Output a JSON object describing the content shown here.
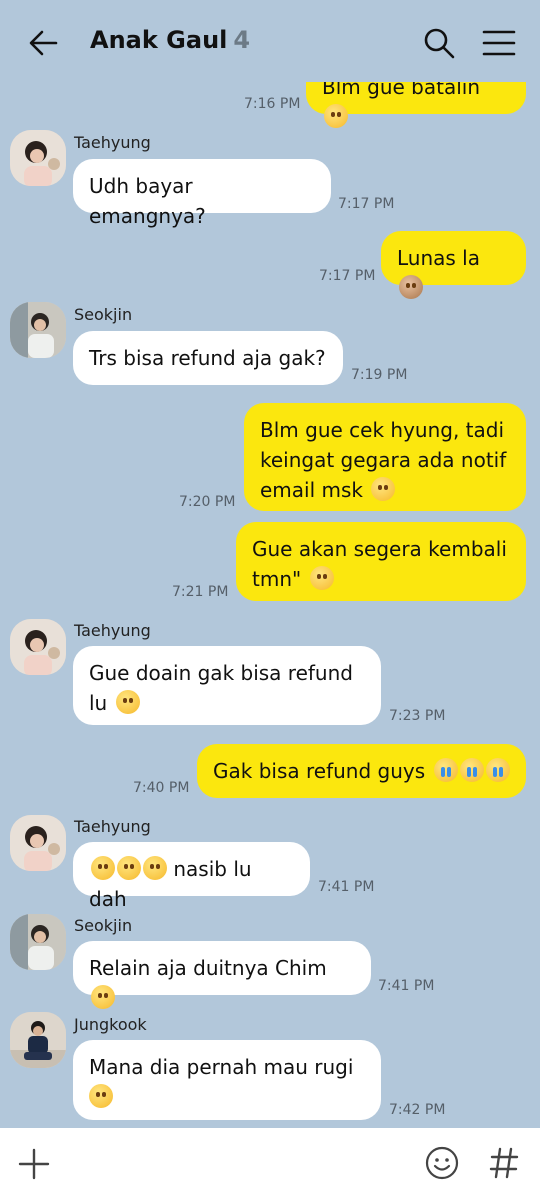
{
  "header": {
    "title": "Anak Gaul",
    "member_count": "4",
    "icons": {
      "back": "arrow-left-icon",
      "search": "search-icon",
      "menu": "hamburger-menu-icon"
    }
  },
  "messages": [
    {
      "type": "out",
      "text": "Blm gue batalin",
      "emoji": "😅",
      "time": "7:16 PM"
    },
    {
      "type": "in",
      "sender": "Taehyung",
      "text": "Udh bayar emangnya?",
      "time": "7:17 PM"
    },
    {
      "type": "out",
      "text": "Lunas la",
      "emoji": "🙈",
      "time": "7:17 PM"
    },
    {
      "type": "in",
      "sender": "Seokjin",
      "text": "Trs bisa refund aja gak?",
      "time": "7:19 PM"
    },
    {
      "type": "out",
      "lines": [
        "Blm gue cek hyung, tadi",
        "keingat gegara ada notif",
        "email msk"
      ],
      "emoji": "😅",
      "time": "7:20 PM"
    },
    {
      "type": "out",
      "lines": [
        "Gue akan segera kembali",
        "tmn\""
      ],
      "emoji": "🫡",
      "time": "7:21 PM"
    },
    {
      "type": "in",
      "sender": "Taehyung",
      "lines": [
        "Gue doain gak bisa refund",
        "lu"
      ],
      "emoji": "😂",
      "time": "7:23 PM"
    },
    {
      "type": "out",
      "text": "Gak bisa refund guys",
      "emoji": "😭😭😭",
      "time": "7:40 PM"
    },
    {
      "type": "in",
      "sender": "Taehyung",
      "prefix_emoji": "🤣🤣🤣",
      "text": "nasib lu dah",
      "time": "7:41 PM"
    },
    {
      "type": "in",
      "sender": "Seokjin",
      "text": "Relain aja duitnya Chim",
      "emoji": "😌",
      "time": "7:41 PM"
    },
    {
      "type": "in",
      "sender": "Jungkook",
      "lines": [
        "Mana dia pernah mau rugi",
        ""
      ],
      "emoji": "🤔",
      "time": "7:42 PM"
    }
  ],
  "bottom_bar": {
    "icons": {
      "attach": "plus-icon",
      "emoji": "smiley-icon",
      "hashtag": "hashtag-icon"
    }
  }
}
